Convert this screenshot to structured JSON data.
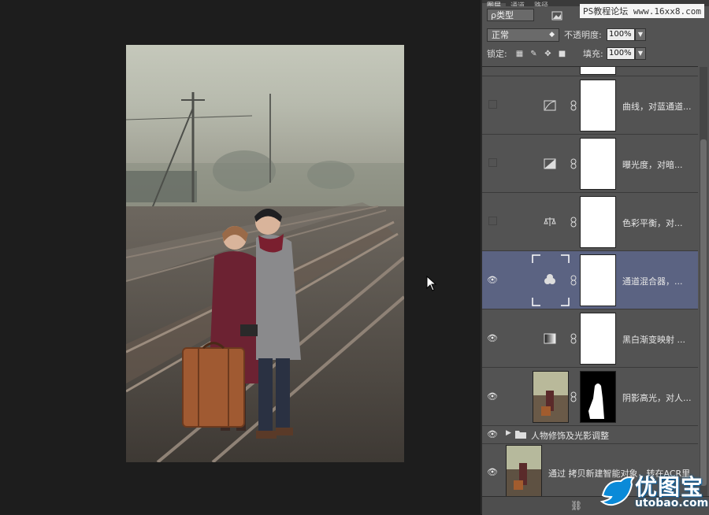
{
  "panel": {
    "tabs": [
      "图层",
      "通道",
      "路径"
    ],
    "watermark": "PS教程论坛 www.16xx8.com",
    "filter_label": "ρ类型",
    "blend_mode": "正常",
    "opacity_label": "不透明度:",
    "opacity_value": "100%",
    "lock_label": "锁定:",
    "fill_label": "填充:",
    "fill_value": "100%"
  },
  "layers": [
    {
      "name": "曲线，对蓝通道...",
      "visible": false,
      "icon": "curves-icon",
      "selected": false
    },
    {
      "name": "曝光度，对暗...",
      "visible": false,
      "icon": "exposure-icon",
      "selected": false
    },
    {
      "name": "色彩平衡，对...",
      "visible": false,
      "icon": "color-balance-icon",
      "selected": false
    },
    {
      "name": "通道混合器，...",
      "visible": true,
      "icon": "channel-mixer-icon",
      "selected": true
    },
    {
      "name": "黑白渐变映射 ...",
      "visible": true,
      "icon": "gradient-map-icon",
      "selected": false
    },
    {
      "name": "阴影高光，对人...",
      "visible": true,
      "icon": "photo-thumbnail",
      "selected": false
    }
  ],
  "group": {
    "name": "人物修饰及光影调整",
    "visible": true
  },
  "smart_layer": {
    "name": "通过 拷贝新建智能对象，转在ACR里",
    "visible": true
  },
  "watermark_logo": {
    "main": "优图宝",
    "url": "utobao.com"
  },
  "colors": {
    "selected_row": "#5b6382",
    "panel_bg": "#535353",
    "canvas_bg": "#1d1d1d",
    "logo_blue": "#0a8ad8"
  }
}
